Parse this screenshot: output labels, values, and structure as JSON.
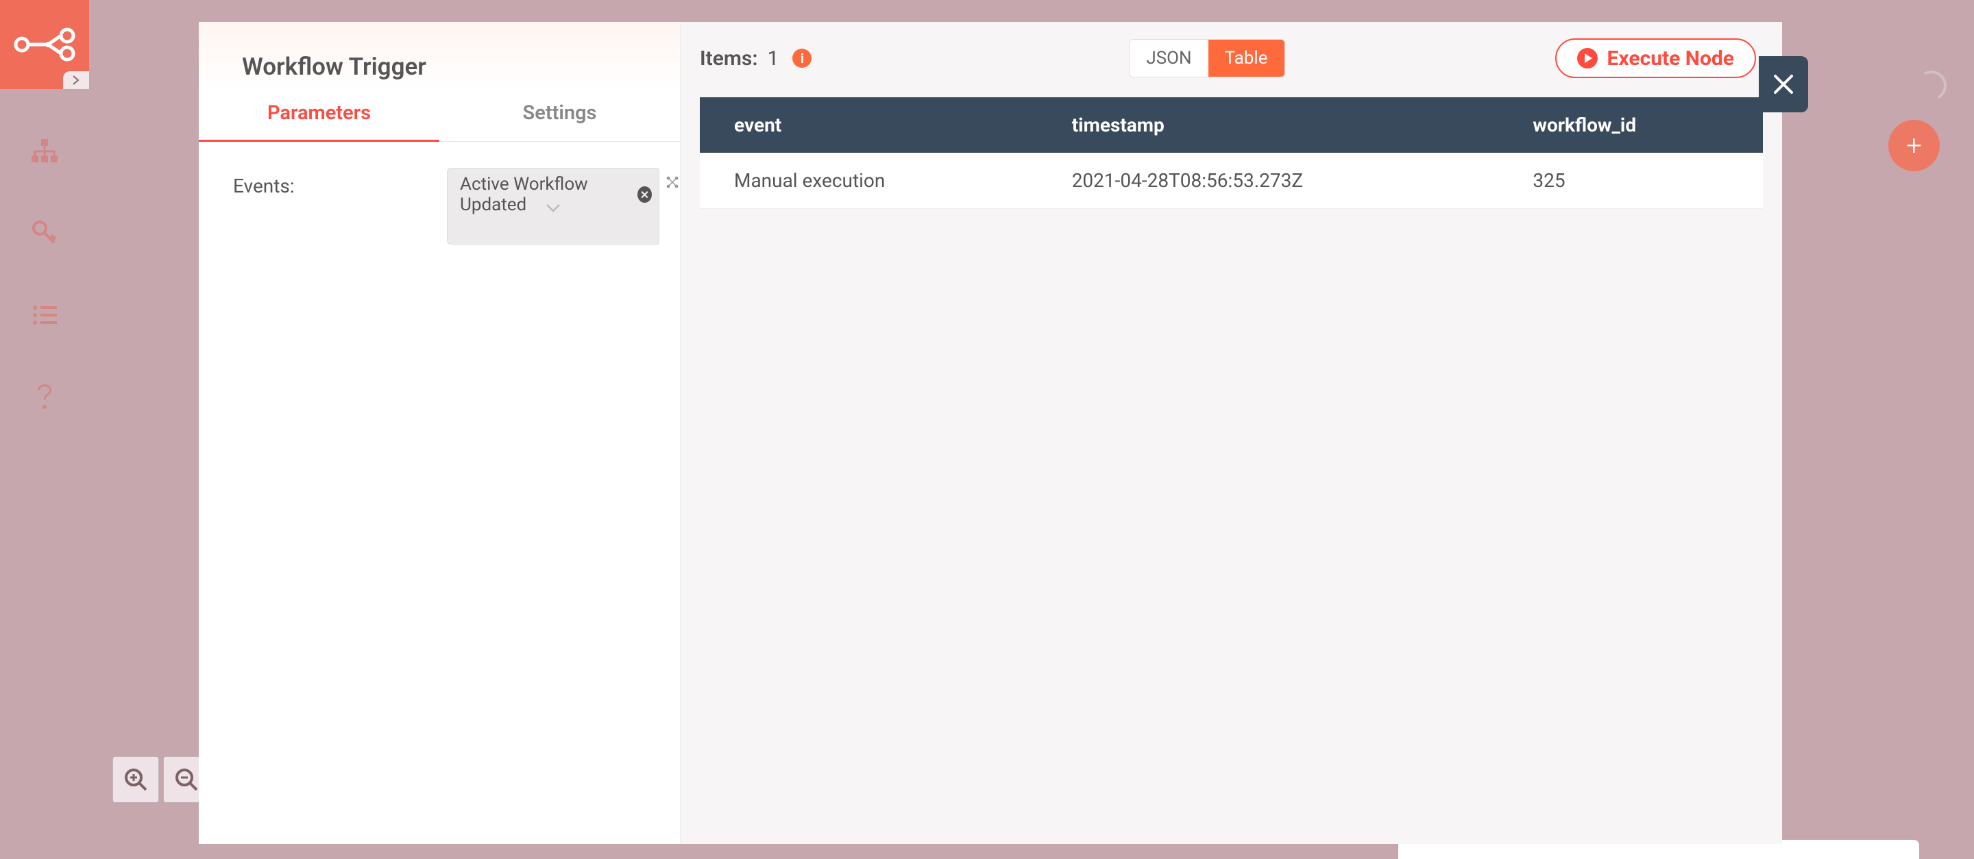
{
  "sidebar": {
    "logo": "n8n",
    "items": [
      {
        "name": "workflows-icon"
      },
      {
        "name": "credentials-icon"
      },
      {
        "name": "executions-icon"
      },
      {
        "name": "help-icon"
      }
    ]
  },
  "modal": {
    "title": "Workflow Trigger",
    "tabs": {
      "parameters": "Parameters",
      "settings": "Settings",
      "active": "parameters"
    },
    "params": {
      "events_label": "Events:",
      "events_value": "Active Workflow Updated"
    },
    "results": {
      "items_label": "Items:",
      "count": "1",
      "view_toggle": {
        "json": "JSON",
        "table": "Table",
        "active": "table"
      },
      "execute_label": "Execute Node",
      "columns": [
        "event",
        "timestamp",
        "workflow_id"
      ],
      "rows": [
        {
          "event": "Manual execution",
          "timestamp": "2021-04-28T08:56:53.273Z",
          "workflow_id": "325"
        }
      ]
    }
  },
  "fab": "+",
  "zoom": {
    "in": "zoom-in",
    "out": "zoom-out"
  }
}
